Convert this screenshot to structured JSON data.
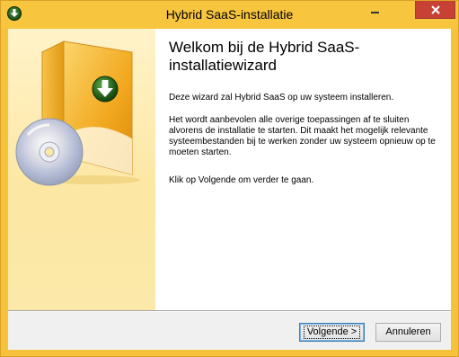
{
  "window": {
    "title": "Hybrid SaaS-installatie"
  },
  "icons": {
    "app": "download-arrow-icon",
    "banner": "installer-box-cd-icon",
    "minimize": "minimize-icon",
    "close": "close-icon"
  },
  "colors": {
    "titlebar": "#f7c53e",
    "close_button": "#c74134",
    "banner_bg": "#fde7a4",
    "content_bg": "#ffffff"
  },
  "content": {
    "heading": "Welkom bij de Hybrid SaaS-installatiewizard",
    "paragraph1": "Deze wizard zal Hybrid SaaS op uw systeem installeren.",
    "paragraph2": "Het wordt aanbevolen alle overige toepassingen af te sluiten alvorens de installatie te starten. Dit maakt het mogelijk relevante systeembestanden bij te werken zonder uw systeem opnieuw op te moeten starten.",
    "paragraph3": "Klik op Volgende om verder te gaan."
  },
  "buttons": {
    "next_label": "Volgende >",
    "cancel_label": "Annuleren"
  }
}
